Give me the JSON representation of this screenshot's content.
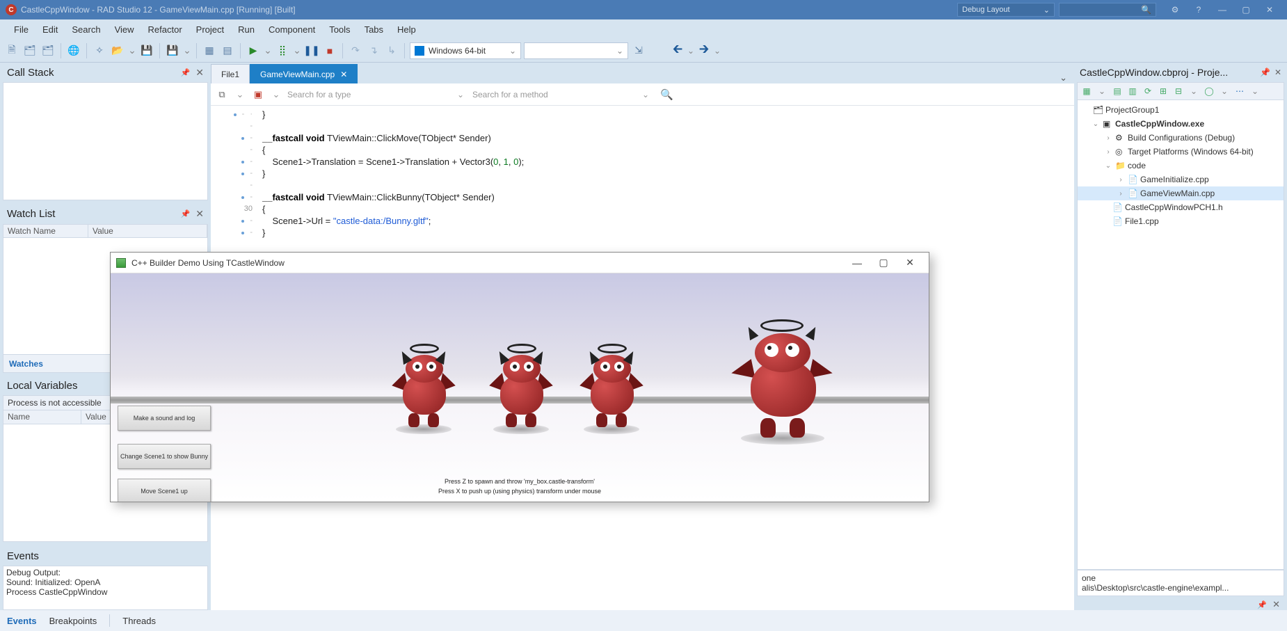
{
  "title_bar": {
    "icon_letter": "C",
    "text": "CastleCppWindow - RAD Studio 12 - GameViewMain.cpp [Running] [Built]",
    "layout_combo": "Debug Layout"
  },
  "menu": [
    "File",
    "Edit",
    "Search",
    "View",
    "Refactor",
    "Project",
    "Run",
    "Component",
    "Tools",
    "Tabs",
    "Help"
  ],
  "toolbar": {
    "target_combo": "Windows 64-bit"
  },
  "left": {
    "call_stack_title": "Call Stack",
    "watch_list_title": "Watch List",
    "watch_cols": [
      "Watch Name",
      "Value"
    ],
    "watch_tab": "Watches",
    "local_vars_title": "Local Variables",
    "local_process_msg": "Process is not accessible",
    "local_cols": [
      "Name",
      "Value"
    ],
    "events_title": "Events",
    "events_lines": [
      "Debug Output:",
      "Sound: Initialized: OpenA",
      "",
      "Process CastleCppWindow"
    ]
  },
  "editor": {
    "tabs": [
      {
        "label": "File1",
        "active": false
      },
      {
        "label": "GameViewMain.cpp",
        "active": true
      }
    ],
    "search_type_placeholder": "Search for a type",
    "search_method_placeholder": "Search for a method",
    "line_number_30": "30",
    "code": {
      "l1": "}",
      "l3a": "__fastcall",
      "l3b": "void",
      "l3c": " TViewMain::ClickMove(TObject* Sender)",
      "l4": "{",
      "l5a": "    Scene1->Translation = Scene1->Translation + Vector3(",
      "l5n1": "0",
      "l5s1": ", ",
      "l5n2": "1",
      "l5s2": ", ",
      "l5n3": "0",
      "l5e": ");",
      "l6": "}",
      "l8a": "__fastcall",
      "l8b": "void",
      "l8c": " TViewMain::ClickBunny(TObject* Sender)",
      "l9": "{",
      "l10a": "    Scene1->Url = ",
      "l10s": "\"castle-data:/Bunny.gltf\"",
      "l10e": ";",
      "l11": "}"
    }
  },
  "project": {
    "title": "CastleCppWindow.cbproj - Proje...",
    "tree": {
      "root": "ProjectGroup1",
      "exe": "CastleCppWindow.exe",
      "build": "Build Configurations (Debug)",
      "target": "Target Platforms (Windows 64-bit)",
      "code": "code",
      "initcpp": "GameInitialize.cpp",
      "viewcpp": "GameViewMain.cpp",
      "pch": "CastleCppWindowPCH1.h",
      "file1": "File1.cpp"
    },
    "bottom_lines": [
      "one",
      "alis\\Desktop\\src\\castle-engine\\exampl..."
    ]
  },
  "game": {
    "title": "C++ Builder Demo Using TCastleWindow",
    "btn1": "Make a sound and log",
    "btn2": "Change Scene1 to show Bunny",
    "btn3": "Move Scene1 up",
    "hint1": "Press Z to spawn and throw 'my_box.castle-transform'",
    "hint2": "Press X to push up (using physics) transform under mouse"
  },
  "bottom_tabs": [
    "Events",
    "Breakpoints",
    "Threads"
  ]
}
